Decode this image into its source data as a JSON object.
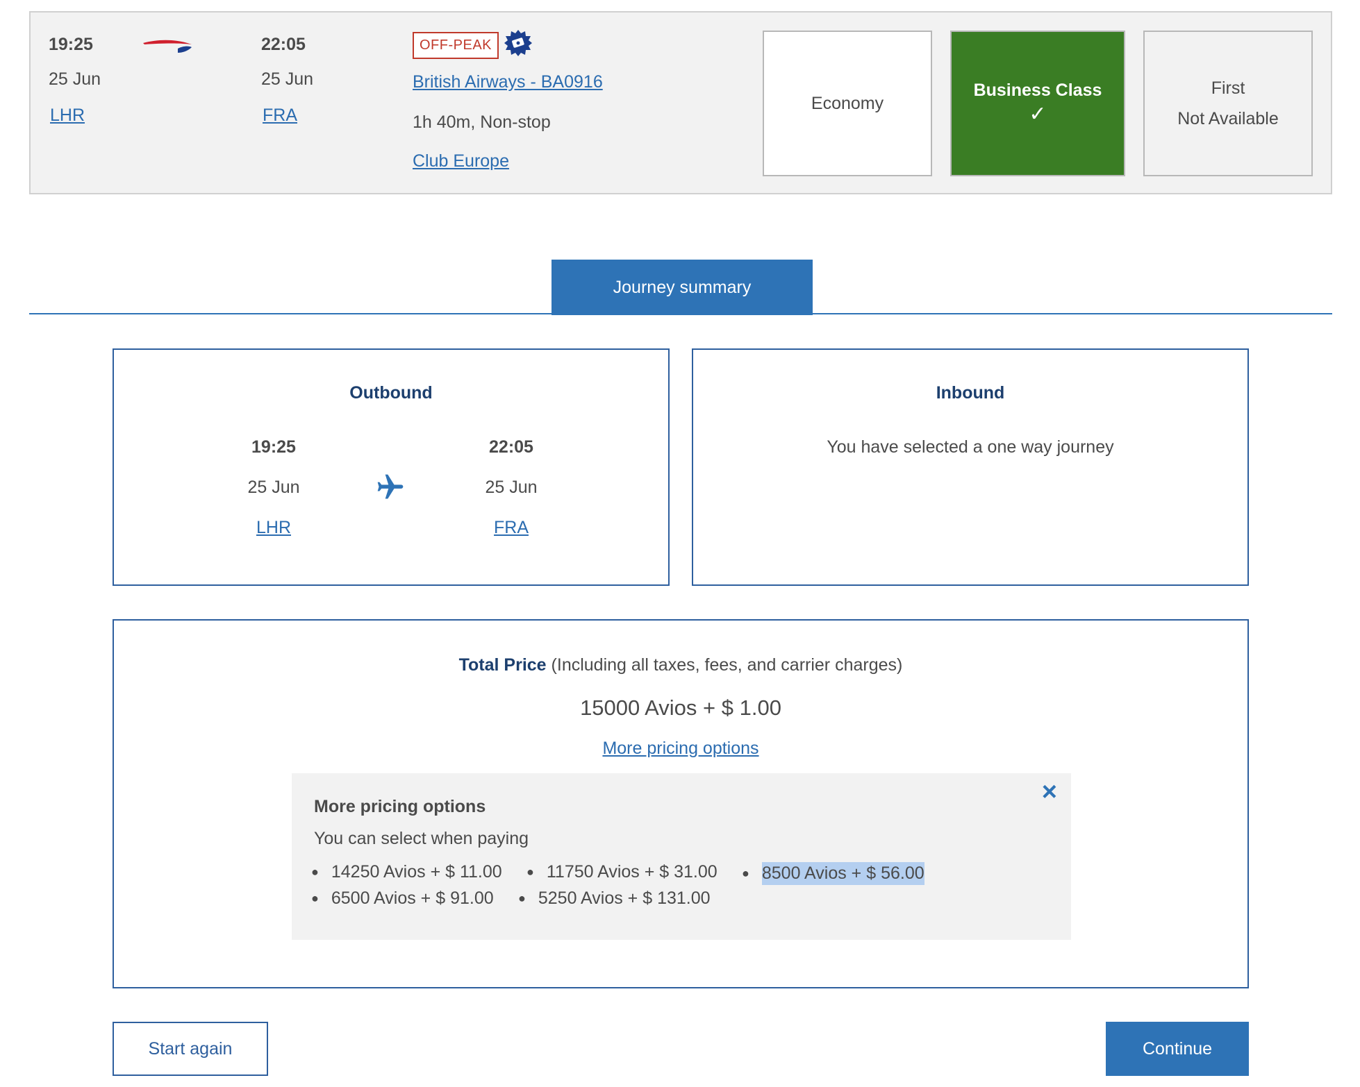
{
  "flight": {
    "departure_time": "19:25",
    "departure_date": "25 Jun",
    "departure_airport": "LHR",
    "arrival_time": "22:05",
    "arrival_date": "25 Jun",
    "arrival_airport": "FRA",
    "badge": "OFF-PEAK",
    "airline_link": "British Airways - BA0916",
    "duration": "1h 40m, Non-stop",
    "cabin_link": "Club Europe",
    "cabins": {
      "economy": "Economy",
      "business": "Business Class",
      "business_check": "✓",
      "first": "First",
      "first_status": "Not Available"
    }
  },
  "tabs": {
    "journey_summary": "Journey summary"
  },
  "outbound": {
    "title": "Outbound",
    "departure_time": "19:25",
    "departure_date": "25 Jun",
    "departure_airport": "LHR",
    "arrival_time": "22:05",
    "arrival_date": "25 Jun",
    "arrival_airport": "FRA"
  },
  "inbound": {
    "title": "Inbound",
    "message": "You have selected a one way journey"
  },
  "price": {
    "label": "Total Price",
    "label_note": "(Including all taxes, fees, and carrier charges)",
    "total": "15000 Avios + $ 1.00",
    "more_link": "More pricing options",
    "more_title": "More pricing options",
    "more_subtitle": "You can select when paying",
    "options": [
      "14250 Avios + $ 11.00",
      "11750 Avios + $ 31.00",
      "8500 Avios + $ 56.00",
      "6500 Avios + $ 91.00",
      "5250 Avios + $ 131.00"
    ],
    "close_icon": "×"
  },
  "actions": {
    "start_again": "Start again",
    "continue": "Continue"
  },
  "colors": {
    "accent": "#2e73b6",
    "business_green": "#3a7d24",
    "offpeak_red": "#c0392b",
    "title_navy": "#1c3f6e"
  },
  "icons": {
    "logo": "speedmarque-logo-icon",
    "offpeak": "badge-icon",
    "plane": "plane-icon",
    "close": "close-icon",
    "check": "check-icon"
  }
}
